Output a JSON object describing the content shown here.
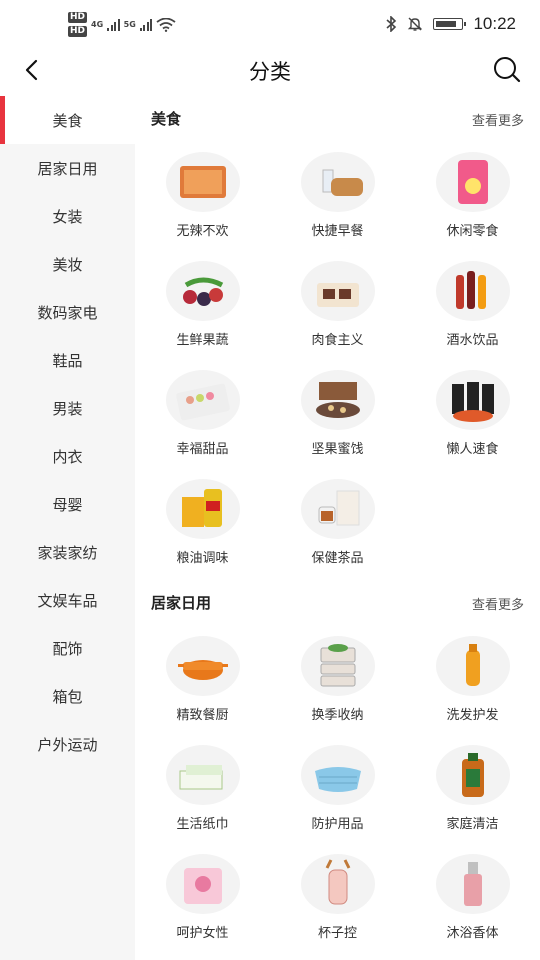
{
  "status_bar": {
    "hd1": "HD",
    "hd2": "HD",
    "net1": "4G",
    "net2": "5G",
    "time": "10:22",
    "battery_level": 0.85
  },
  "header": {
    "title": "分类",
    "back_icon": "chevron-left-icon",
    "search_icon": "search-icon"
  },
  "sidebar": {
    "items": [
      {
        "label": "美食",
        "active": true
      },
      {
        "label": "居家日用"
      },
      {
        "label": "女装"
      },
      {
        "label": "美妆"
      },
      {
        "label": "数码家电"
      },
      {
        "label": "鞋品"
      },
      {
        "label": "男装"
      },
      {
        "label": "内衣"
      },
      {
        "label": "母婴"
      },
      {
        "label": "家装家纺"
      },
      {
        "label": "文娱车品"
      },
      {
        "label": "配饰"
      },
      {
        "label": "箱包"
      },
      {
        "label": "户外运动"
      }
    ],
    "accent_color": "#e8343e"
  },
  "sections": [
    {
      "title": "美食",
      "more": "查看更多",
      "items": [
        {
          "label": "无辣不欢"
        },
        {
          "label": "快捷早餐"
        },
        {
          "label": "休闲零食"
        },
        {
          "label": "生鲜果蔬"
        },
        {
          "label": "肉食主义"
        },
        {
          "label": "酒水饮品"
        },
        {
          "label": "幸福甜品"
        },
        {
          "label": "坚果蜜饯"
        },
        {
          "label": "懒人速食"
        },
        {
          "label": "粮油调味"
        },
        {
          "label": "保健茶品"
        }
      ]
    },
    {
      "title": "居家日用",
      "more": "查看更多",
      "items": [
        {
          "label": "精致餐厨"
        },
        {
          "label": "换季收纳"
        },
        {
          "label": "洗发护发"
        },
        {
          "label": "生活纸巾"
        },
        {
          "label": "防护用品"
        },
        {
          "label": "家庭清洁"
        },
        {
          "label": "呵护女性"
        },
        {
          "label": "杯子控"
        },
        {
          "label": "沐浴香体"
        }
      ]
    }
  ]
}
